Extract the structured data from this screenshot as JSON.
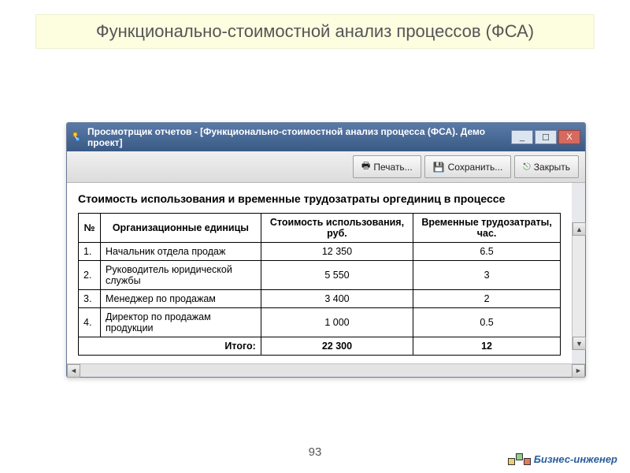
{
  "slide": {
    "title": "Функционально-стоимостной анализ процессов (ФСА)",
    "page_number": "93"
  },
  "window": {
    "title": "Просмотрщик отчетов -  [Функционально-стоимостной анализ процесса (ФСА). Демо проект]",
    "min": "_",
    "max": "☐",
    "close": "X"
  },
  "toolbar": {
    "print": "Печать...",
    "save": "Сохранить...",
    "close": "Закрыть"
  },
  "report": {
    "heading": "Стоимость использования и временные трудозатраты оргединиц в процессе",
    "headers": {
      "num": "№",
      "unit": "Организационные единицы",
      "cost": "Стоимость использования, руб.",
      "time": "Временные трудозатраты, час."
    },
    "rows": [
      {
        "num": "1.",
        "unit": "Начальник отдела продаж",
        "cost": "12 350",
        "time": "6.5"
      },
      {
        "num": "2.",
        "unit": "Руководитель юридической службы",
        "cost": "5 550",
        "time": "3"
      },
      {
        "num": "3.",
        "unit": "Менеджер по продажам",
        "cost": "3 400",
        "time": "2"
      },
      {
        "num": "4.",
        "unit": "Директор по продажам продукции",
        "cost": "1 000",
        "time": "0.5"
      }
    ],
    "total": {
      "label": "Итого:",
      "cost": "22 300",
      "time": "12"
    }
  },
  "scroll": {
    "left": "◄",
    "right": "►",
    "up": "▲",
    "down": "▼"
  },
  "brand": {
    "label": "Бизнес-инженер"
  }
}
